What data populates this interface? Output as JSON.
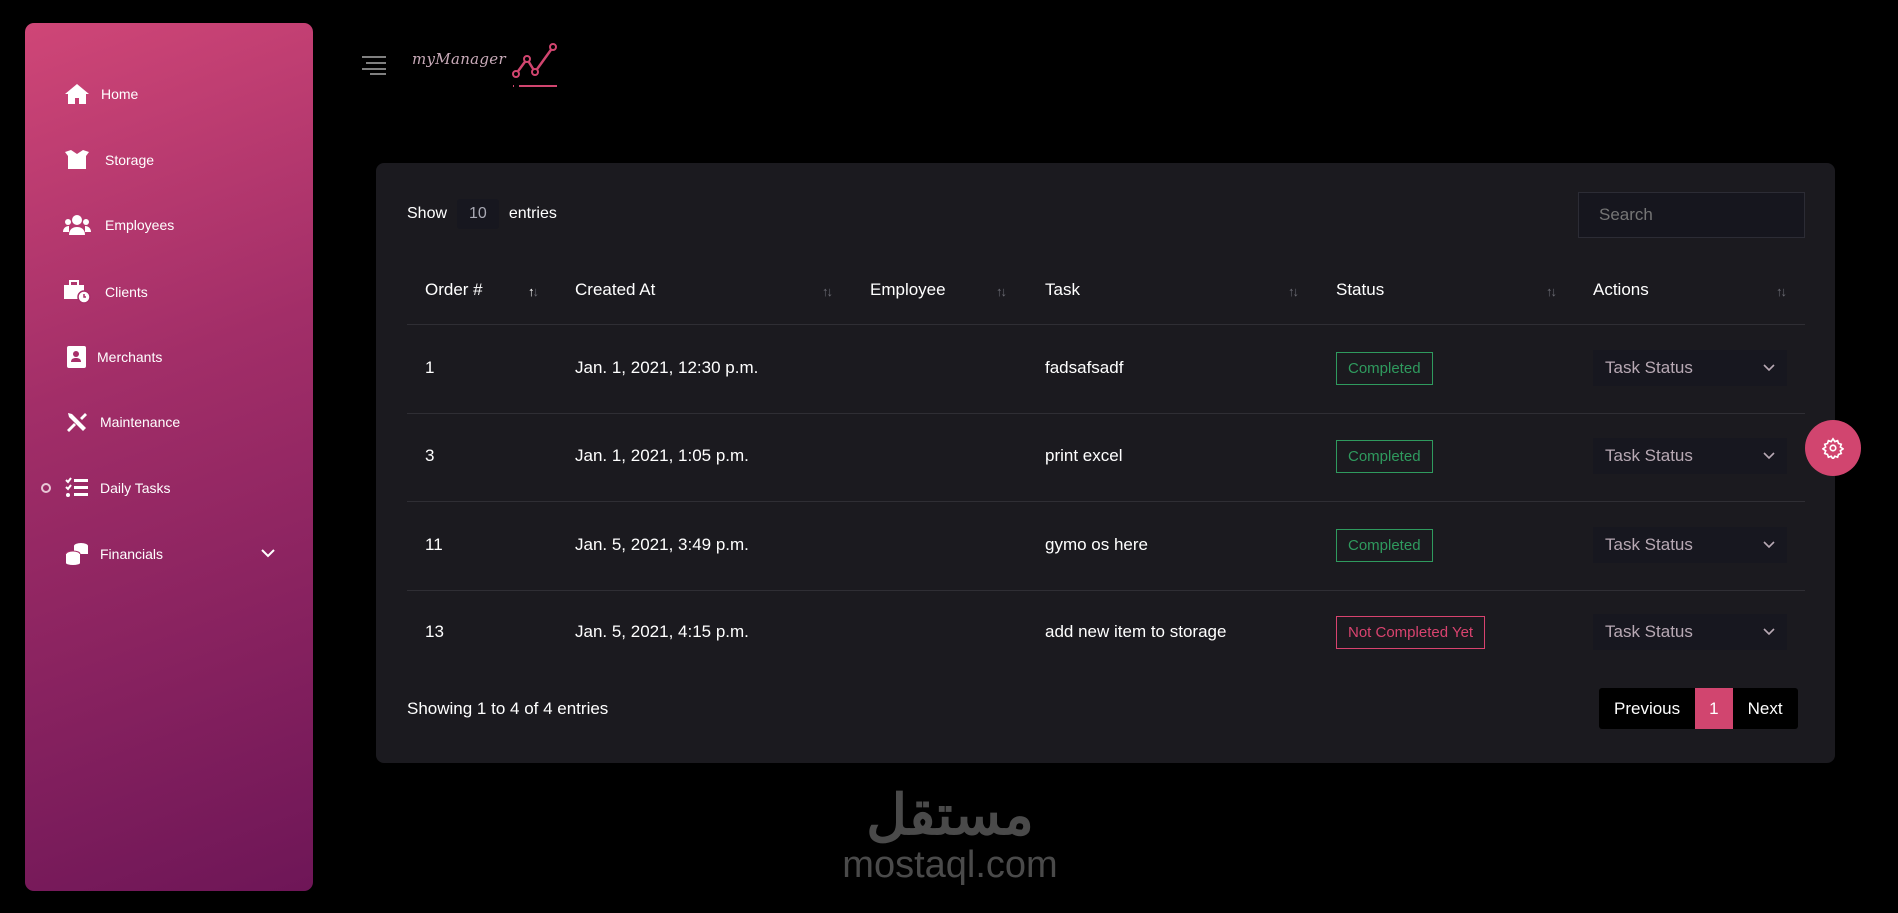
{
  "brand": {
    "name": "myManager",
    "accent": "#d1456f"
  },
  "sidebar": {
    "items": [
      {
        "label": "Home",
        "icon": "home-icon"
      },
      {
        "label": "Storage",
        "icon": "box-icon"
      },
      {
        "label": "Employees",
        "icon": "users-icon"
      },
      {
        "label": "Clients",
        "icon": "briefcase-clock-icon"
      },
      {
        "label": "Merchants",
        "icon": "address-book-icon"
      },
      {
        "label": "Maintenance",
        "icon": "tools-icon"
      },
      {
        "label": "Daily Tasks",
        "icon": "tasks-icon",
        "active": true
      },
      {
        "label": "Financials",
        "icon": "coins-icon",
        "has_submenu": true
      }
    ]
  },
  "table": {
    "show_label": "Show",
    "entries_label": "entries",
    "page_length": "10",
    "search_placeholder": "Search",
    "columns": [
      "Order #",
      "Created At",
      "Employee",
      "Task",
      "Status",
      "Actions"
    ],
    "rows": [
      {
        "order": "1",
        "created": "Jan. 1, 2021, 12:30 p.m.",
        "employee": "",
        "task": "fadsafsadf",
        "status": "Completed",
        "action": "Task Status"
      },
      {
        "order": "3",
        "created": "Jan. 1, 2021, 1:05 p.m.",
        "employee": "",
        "task": "print excel",
        "status": "Completed",
        "action": "Task Status"
      },
      {
        "order": "11",
        "created": "Jan. 5, 2021, 3:49 p.m.",
        "employee": "",
        "task": "gymo os here",
        "status": "Completed",
        "action": "Task Status"
      },
      {
        "order": "13",
        "created": "Jan. 5, 2021, 4:15 p.m.",
        "employee": "",
        "task": "add new item to storage",
        "status": "Not Completed Yet",
        "action": "Task Status"
      }
    ],
    "info": "Showing 1 to 4 of 4 entries",
    "pagination": {
      "previous": "Previous",
      "current": "1",
      "next": "Next"
    },
    "status_colors": {
      "Completed": "#2f9a5e",
      "Not Completed Yet": "#d8436f"
    }
  },
  "watermark": {
    "arabic": "مستقل",
    "latin": "mostaql.com"
  }
}
